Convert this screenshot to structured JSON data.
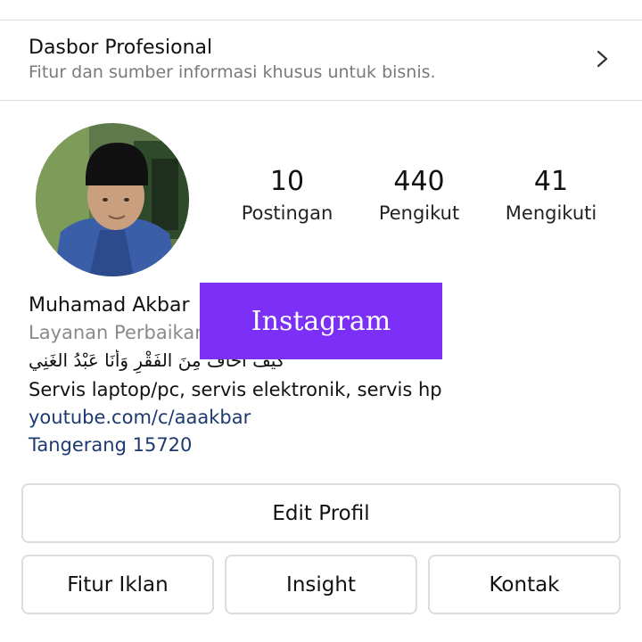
{
  "dashboard": {
    "title": "Dasbor Profesional",
    "subtitle": "Fitur dan sumber informasi khusus untuk bisnis.",
    "chevron_icon": "chevron-right-icon"
  },
  "profile": {
    "avatar_icon": "profile-photo",
    "stats": [
      {
        "value": "10",
        "label": "Postingan"
      },
      {
        "value": "440",
        "label": "Pengikut"
      },
      {
        "value": "41",
        "label": "Mengikuti"
      }
    ],
    "name": "Muhamad Akbar",
    "category": "Layanan Perbaikan",
    "bio_arabic": "كيف أخاف مِنَ الفَقْرِ وَأنَا عَبْدُ الغَنِي",
    "bio_text": "Servis laptop/pc, servis elektronik, servis hp",
    "link": "youtube.com/c/aaakbar",
    "location": "Tangerang 15720"
  },
  "watermark": {
    "text": "Instagram",
    "color": "#7b2ff7"
  },
  "buttons": {
    "edit_profile": "Edit Profil",
    "ads_tools": "Fitur Iklan",
    "insight": "Insight",
    "contact": "Kontak"
  },
  "colors": {
    "link": "#1d3a6e",
    "border": "#dcdcdc",
    "muted": "#7a7a7a"
  }
}
